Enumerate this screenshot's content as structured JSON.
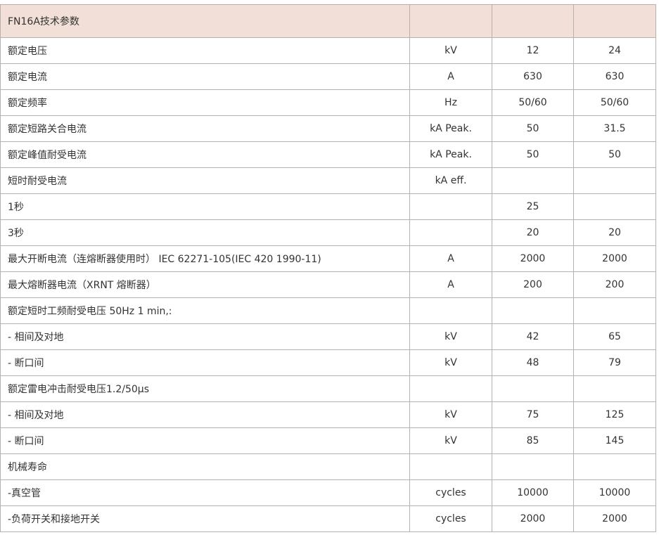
{
  "table": {
    "header": [
      "FN16A技术参数",
      "",
      "",
      ""
    ],
    "rows": [
      [
        "额定电压",
        "kV",
        "12",
        "24"
      ],
      [
        "额定电流",
        "A",
        "630",
        "630"
      ],
      [
        "额定频率",
        "Hz",
        "50/60",
        "50/60"
      ],
      [
        "额定短路关合电流",
        "kA Peak.",
        "50",
        "31.5"
      ],
      [
        "额定峰值耐受电流",
        "kA Peak.",
        "50",
        "50"
      ],
      [
        "短时耐受电流",
        "kA eff.",
        "",
        ""
      ],
      [
        "1秒",
        "",
        "25",
        ""
      ],
      [
        "3秒",
        "",
        "20",
        "20"
      ],
      [
        "最大开断电流（连熔断器使用时） IEC 62271-105(IEC 420 1990-11)",
        "A",
        "2000",
        "2000"
      ],
      [
        "最大熔断器电流（XRNT 熔断器）",
        "A",
        "200",
        "200"
      ],
      [
        "额定短时工频耐受电压  50Hz 1 min,:",
        "",
        "",
        ""
      ],
      [
        "- 相间及对地",
        "kV",
        "42",
        "65"
      ],
      [
        "- 断口间",
        "kV",
        "48",
        "79"
      ],
      [
        "额定雷电冲击耐受电压1.2/50μs",
        "",
        "",
        ""
      ],
      [
        "- 相间及对地",
        "kV",
        "75",
        "125"
      ],
      [
        "- 断口间",
        "kV",
        "85",
        "145"
      ],
      [
        "机械寿命",
        "",
        "",
        ""
      ],
      [
        "-真空管",
        "cycles",
        "10000",
        "10000"
      ],
      [
        "-负荷开关和接地开关",
        "cycles",
        "2000",
        "2000"
      ]
    ]
  }
}
